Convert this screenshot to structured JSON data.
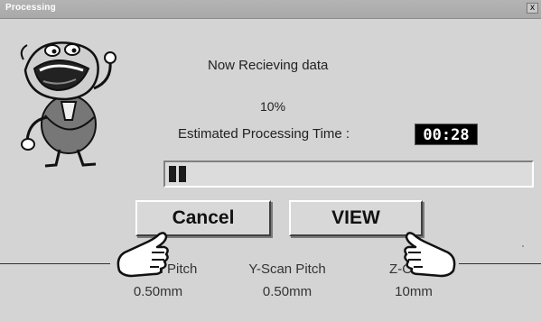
{
  "window": {
    "title": "Processing",
    "close_glyph": "x"
  },
  "status_text": "Now Recieving data",
  "progress": {
    "percent_text": "10%",
    "fraction": 0.1
  },
  "estimate": {
    "label": "Estimated Processing Time :",
    "time": "00:28"
  },
  "buttons": {
    "cancel": "Cancel",
    "view": "VIEW"
  },
  "params": [
    {
      "label": "X-Scan Pitch",
      "value": "0.50mm"
    },
    {
      "label": "Y-Scan Pitch",
      "value": "0.50mm"
    },
    {
      "label": "Z-Offset",
      "value": "10mm"
    }
  ],
  "icons": [
    "close-icon",
    "cartoon-mascot-icon",
    "pointing-hand-icon"
  ]
}
